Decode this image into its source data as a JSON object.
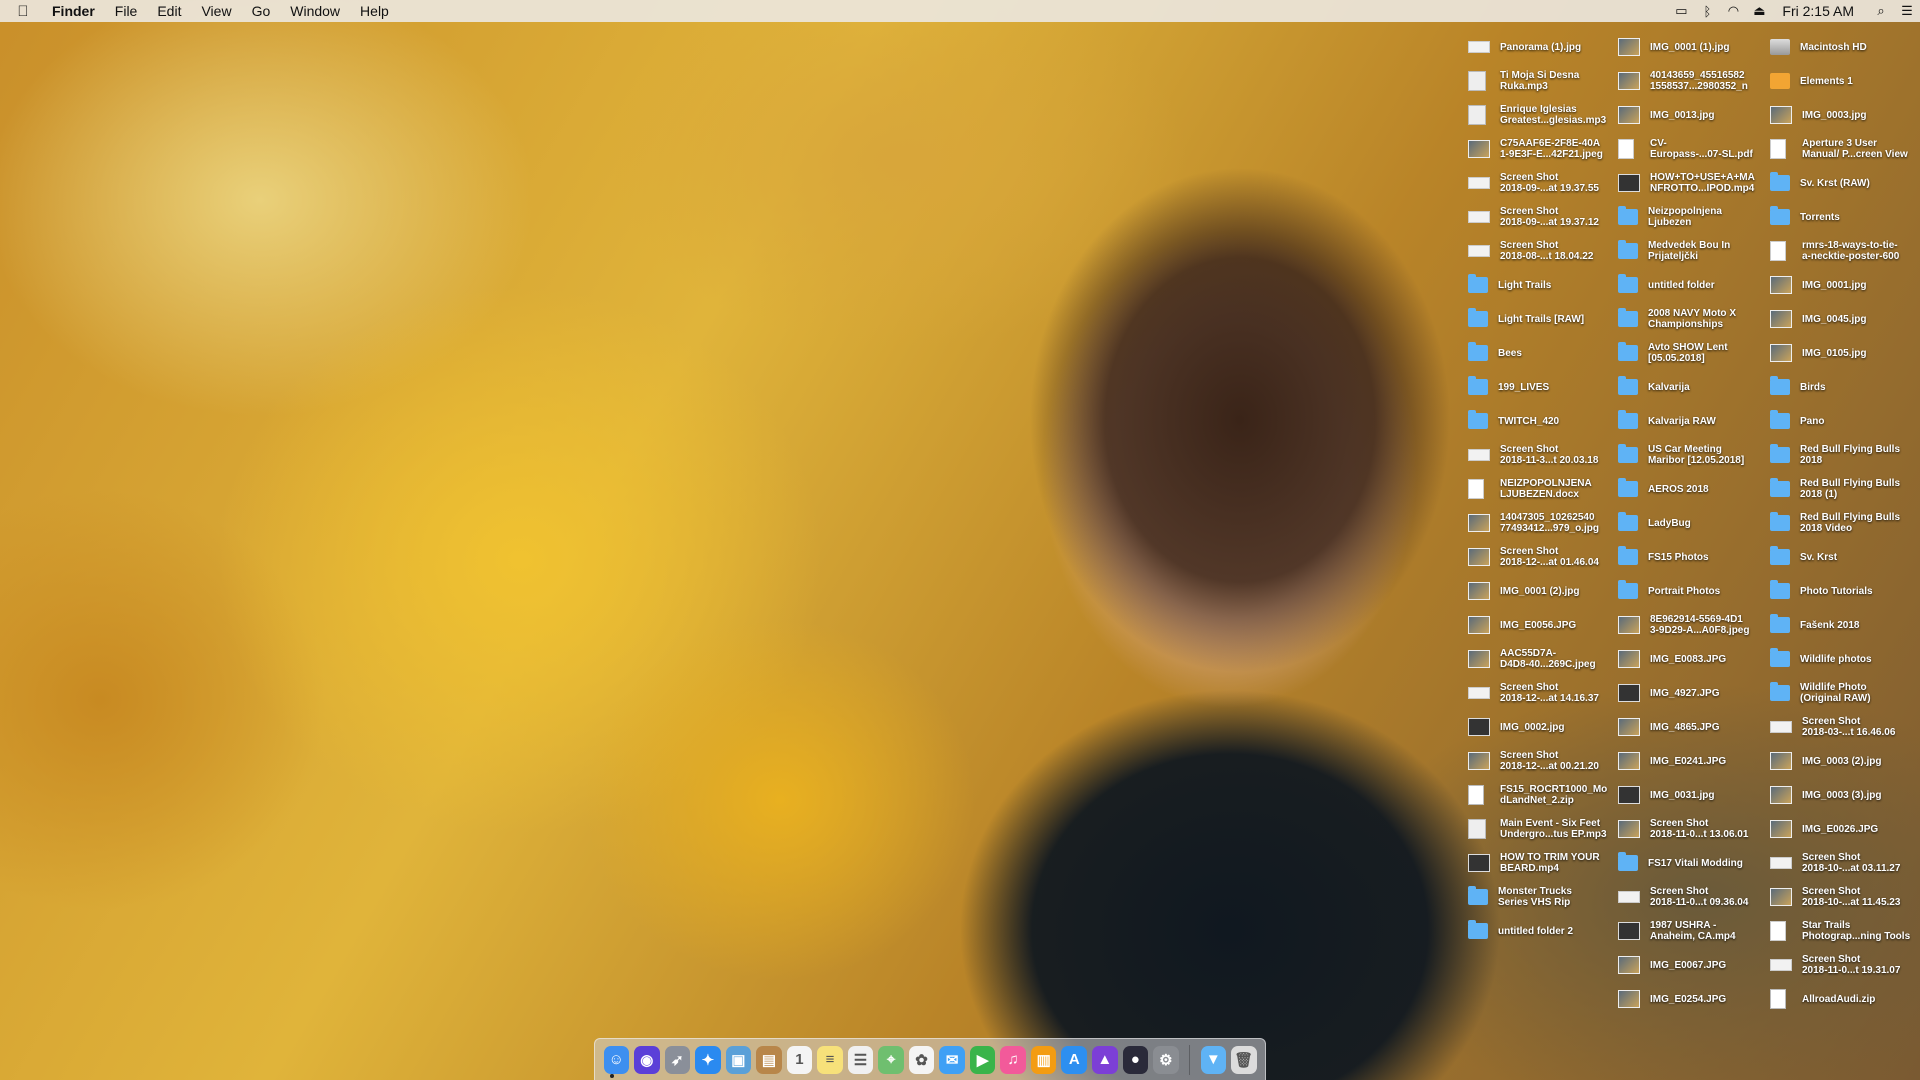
{
  "menubar": {
    "app": "Finder",
    "menus": [
      "File",
      "Edit",
      "View",
      "Go",
      "Window",
      "Help"
    ],
    "clock": "Fri 2:15 AM",
    "status_icons": [
      "airplay-icon",
      "bluetooth-icon",
      "wifi-icon",
      "eject-icon",
      "spotlight-icon",
      "notification-center-icon"
    ]
  },
  "desktop": {
    "columns": [
      [
        {
          "label": "Panorama (1).jpg",
          "kind": "shot"
        },
        {
          "label": "Ti Moja Si Desna\nRuka.mp3",
          "kind": "audio"
        },
        {
          "label": "Enrique Iglesias\nGreatest...glesias.mp3",
          "kind": "audio"
        },
        {
          "label": "C75AAF6E-2F8E-40A\n1-9E3F-E...42F21.jpeg",
          "kind": "image"
        },
        {
          "label": "Screen Shot\n2018-09-...at 19.37.55",
          "kind": "shot"
        },
        {
          "label": "Screen Shot\n2018-09-...at 19.37.12",
          "kind": "shot"
        },
        {
          "label": "Screen Shot\n2018-08-...t 18.04.22",
          "kind": "shot"
        },
        {
          "label": "Light Trails",
          "kind": "folder"
        },
        {
          "label": "Light Trails [RAW]",
          "kind": "folder"
        },
        {
          "label": "Bees",
          "kind": "folder"
        },
        {
          "label": "199_LIVES",
          "kind": "folder"
        },
        {
          "label": "TWITCH_420",
          "kind": "folder"
        },
        {
          "label": "Screen Shot\n2018-11-3...t 20.03.18",
          "kind": "shot"
        },
        {
          "label": "NEIZPOPOLNJENA\nLJUBEZEN.docx",
          "kind": "doc"
        },
        {
          "label": "14047305_10262540\n77493412...979_o.jpg",
          "kind": "image"
        },
        {
          "label": "Screen Shot\n2018-12-...at 01.46.04",
          "kind": "image"
        },
        {
          "label": "IMG_0001 (2).jpg",
          "kind": "image"
        },
        {
          "label": "IMG_E0056.JPG",
          "kind": "image"
        },
        {
          "label": "AAC55D7A-\nD4D8-40...269C.jpeg",
          "kind": "image"
        },
        {
          "label": "Screen Shot\n2018-12-...at 14.16.37",
          "kind": "shot"
        },
        {
          "label": "IMG_0002.jpg",
          "kind": "video"
        },
        {
          "label": "Screen Shot\n2018-12-...at 00.21.20",
          "kind": "image"
        },
        {
          "label": "FS15_ROCRT1000_Mo\ndLandNet_2.zip",
          "kind": "zip"
        },
        {
          "label": "Main Event - Six Feet\nUndergro...tus EP.mp3",
          "kind": "audio"
        },
        {
          "label": "HOW TO TRIM YOUR\nBEARD.mp4",
          "kind": "video"
        },
        {
          "label": "Monster Trucks\nSeries VHS Rip",
          "kind": "folder"
        },
        {
          "label": "untitled folder 2",
          "kind": "folder"
        }
      ],
      [
        {
          "label": "IMG_0001 (1).jpg",
          "kind": "image"
        },
        {
          "label": "40143659_45516582\n1558537...2980352_n",
          "kind": "image"
        },
        {
          "label": "IMG_0013.jpg",
          "kind": "image"
        },
        {
          "label": "CV-\nEuropass-...07-SL.pdf",
          "kind": "doc"
        },
        {
          "label": "HOW+TO+USE+A+MA\nNFROTTO...IPOD.mp4",
          "kind": "video"
        },
        {
          "label": "Neizpopolnjena\nLjubezen",
          "kind": "folder"
        },
        {
          "label": "Medvedek Bou In\nPrijateljčki",
          "kind": "folder"
        },
        {
          "label": "untitled folder",
          "kind": "folder"
        },
        {
          "label": "2008 NAVY Moto X\nChampionships",
          "kind": "folder"
        },
        {
          "label": "Avto SHOW Lent\n[05.05.2018]",
          "kind": "folder"
        },
        {
          "label": "Kalvarija",
          "kind": "folder"
        },
        {
          "label": "Kalvarija RAW",
          "kind": "folder"
        },
        {
          "label": "US Car Meeting\nMaribor [12.05.2018]",
          "kind": "folder"
        },
        {
          "label": "AEROS 2018",
          "kind": "folder"
        },
        {
          "label": "LadyBug",
          "kind": "folder"
        },
        {
          "label": "FS15 Photos",
          "kind": "folder"
        },
        {
          "label": "Portrait Photos",
          "kind": "folder"
        },
        {
          "label": "8E962914-5569-4D1\n3-9D29-A...A0F8.jpeg",
          "kind": "image"
        },
        {
          "label": "IMG_E0083.JPG",
          "kind": "image"
        },
        {
          "label": "IMG_4927.JPG",
          "kind": "video"
        },
        {
          "label": "IMG_4865.JPG",
          "kind": "image"
        },
        {
          "label": "IMG_E0241.JPG",
          "kind": "image"
        },
        {
          "label": "IMG_0031.jpg",
          "kind": "video"
        },
        {
          "label": "Screen Shot\n2018-11-0...t 13.06.01",
          "kind": "image"
        },
        {
          "label": "FS17 Vitali Modding",
          "kind": "folder"
        },
        {
          "label": "Screen Shot\n2018-11-0...t 09.36.04",
          "kind": "shot"
        },
        {
          "label": "1987 USHRA -\nAnaheim, CA.mp4",
          "kind": "video"
        },
        {
          "label": "IMG_E0067.JPG",
          "kind": "image"
        },
        {
          "label": "IMG_E0254.JPG",
          "kind": "image"
        }
      ],
      [
        {
          "label": "Macintosh HD",
          "kind": "disk"
        },
        {
          "label": "Elements 1",
          "kind": "orange"
        },
        {
          "label": "IMG_0003.jpg",
          "kind": "image"
        },
        {
          "label": "Aperture 3 User\nManual/ P...creen View",
          "kind": "doc"
        },
        {
          "label": "Sv. Krst (RAW)",
          "kind": "folder"
        },
        {
          "label": "Torrents",
          "kind": "folder"
        },
        {
          "label": "rmrs-18-ways-to-tie-\na-necktie-poster-600",
          "kind": "doc"
        },
        {
          "label": "IMG_0001.jpg",
          "kind": "image"
        },
        {
          "label": "IMG_0045.jpg",
          "kind": "image"
        },
        {
          "label": "IMG_0105.jpg",
          "kind": "image"
        },
        {
          "label": "Birds",
          "kind": "folder"
        },
        {
          "label": "Pano",
          "kind": "folder"
        },
        {
          "label": "Red Bull Flying Bulls\n2018",
          "kind": "folder"
        },
        {
          "label": "Red Bull Flying Bulls\n2018 (1)",
          "kind": "folder"
        },
        {
          "label": "Red Bull Flying Bulls\n2018 Video",
          "kind": "folder"
        },
        {
          "label": "Sv. Krst",
          "kind": "folder"
        },
        {
          "label": "Photo Tutorials",
          "kind": "folder"
        },
        {
          "label": "Fašenk 2018",
          "kind": "folder"
        },
        {
          "label": "Wildlife photos",
          "kind": "folder"
        },
        {
          "label": "Wildlife Photo\n(Original RAW)",
          "kind": "folder"
        },
        {
          "label": "Screen Shot\n2018-03-...t 16.46.06",
          "kind": "shot"
        },
        {
          "label": "IMG_0003 (2).jpg",
          "kind": "image"
        },
        {
          "label": "IMG_0003 (3).jpg",
          "kind": "image"
        },
        {
          "label": "IMG_E0026.JPG",
          "kind": "image"
        },
        {
          "label": "Screen Shot\n2018-10-...at 03.11.27",
          "kind": "shot"
        },
        {
          "label": "Screen Shot\n2018-10-...at 11.45.23",
          "kind": "image"
        },
        {
          "label": "Star Trails\nPhotograp...ning Tools",
          "kind": "doc"
        },
        {
          "label": "Screen Shot\n2018-11-0...t 19.31.07",
          "kind": "shot"
        },
        {
          "label": "AllroadAudi.zip",
          "kind": "zip"
        }
      ]
    ]
  },
  "dock": {
    "apps": [
      {
        "name": "finder-icon",
        "color": "#3d8ff0",
        "glyph": "☺"
      },
      {
        "name": "siri-icon",
        "color": "#5b3fd8",
        "glyph": "◉"
      },
      {
        "name": "launchpad-icon",
        "color": "#8a8f99",
        "glyph": "➶"
      },
      {
        "name": "safari-icon",
        "color": "#2a8af0",
        "glyph": "✦"
      },
      {
        "name": "preview-icon",
        "color": "#5aa0d8",
        "glyph": "▣"
      },
      {
        "name": "contacts-icon",
        "color": "#b8864a",
        "glyph": "▤"
      },
      {
        "name": "calendar-icon",
        "color": "#f4f4f4",
        "glyph": "1"
      },
      {
        "name": "notes-icon",
        "color": "#f7e17a",
        "glyph": "≡"
      },
      {
        "name": "reminders-icon",
        "color": "#f0f0f0",
        "glyph": "☰"
      },
      {
        "name": "maps-icon",
        "color": "#6fbf6f",
        "glyph": "⌖"
      },
      {
        "name": "photos-icon",
        "color": "#f4f4f4",
        "glyph": "✿"
      },
      {
        "name": "messages-icon",
        "color": "#3fa0f5",
        "glyph": "✉"
      },
      {
        "name": "facetime-icon",
        "color": "#39b44a",
        "glyph": "▶"
      },
      {
        "name": "itunes-icon",
        "color": "#f25a9a",
        "glyph": "♫"
      },
      {
        "name": "ibooks-icon",
        "color": "#f39c12",
        "glyph": "▥"
      },
      {
        "name": "app-store-icon",
        "color": "#2d8ff0",
        "glyph": "A"
      },
      {
        "name": "affinity-icon",
        "color": "#7c3fd6",
        "glyph": "▲"
      },
      {
        "name": "lightroom-icon",
        "color": "#2a2a3a",
        "glyph": "●"
      },
      {
        "name": "system-preferences-icon",
        "color": "#8a8d92",
        "glyph": "⚙"
      }
    ],
    "right": [
      {
        "name": "downloads-folder-icon",
        "color": "#5fb3f5",
        "glyph": "▼"
      },
      {
        "name": "trash-icon",
        "color": "#dcdcdc",
        "glyph": "🗑"
      }
    ]
  }
}
